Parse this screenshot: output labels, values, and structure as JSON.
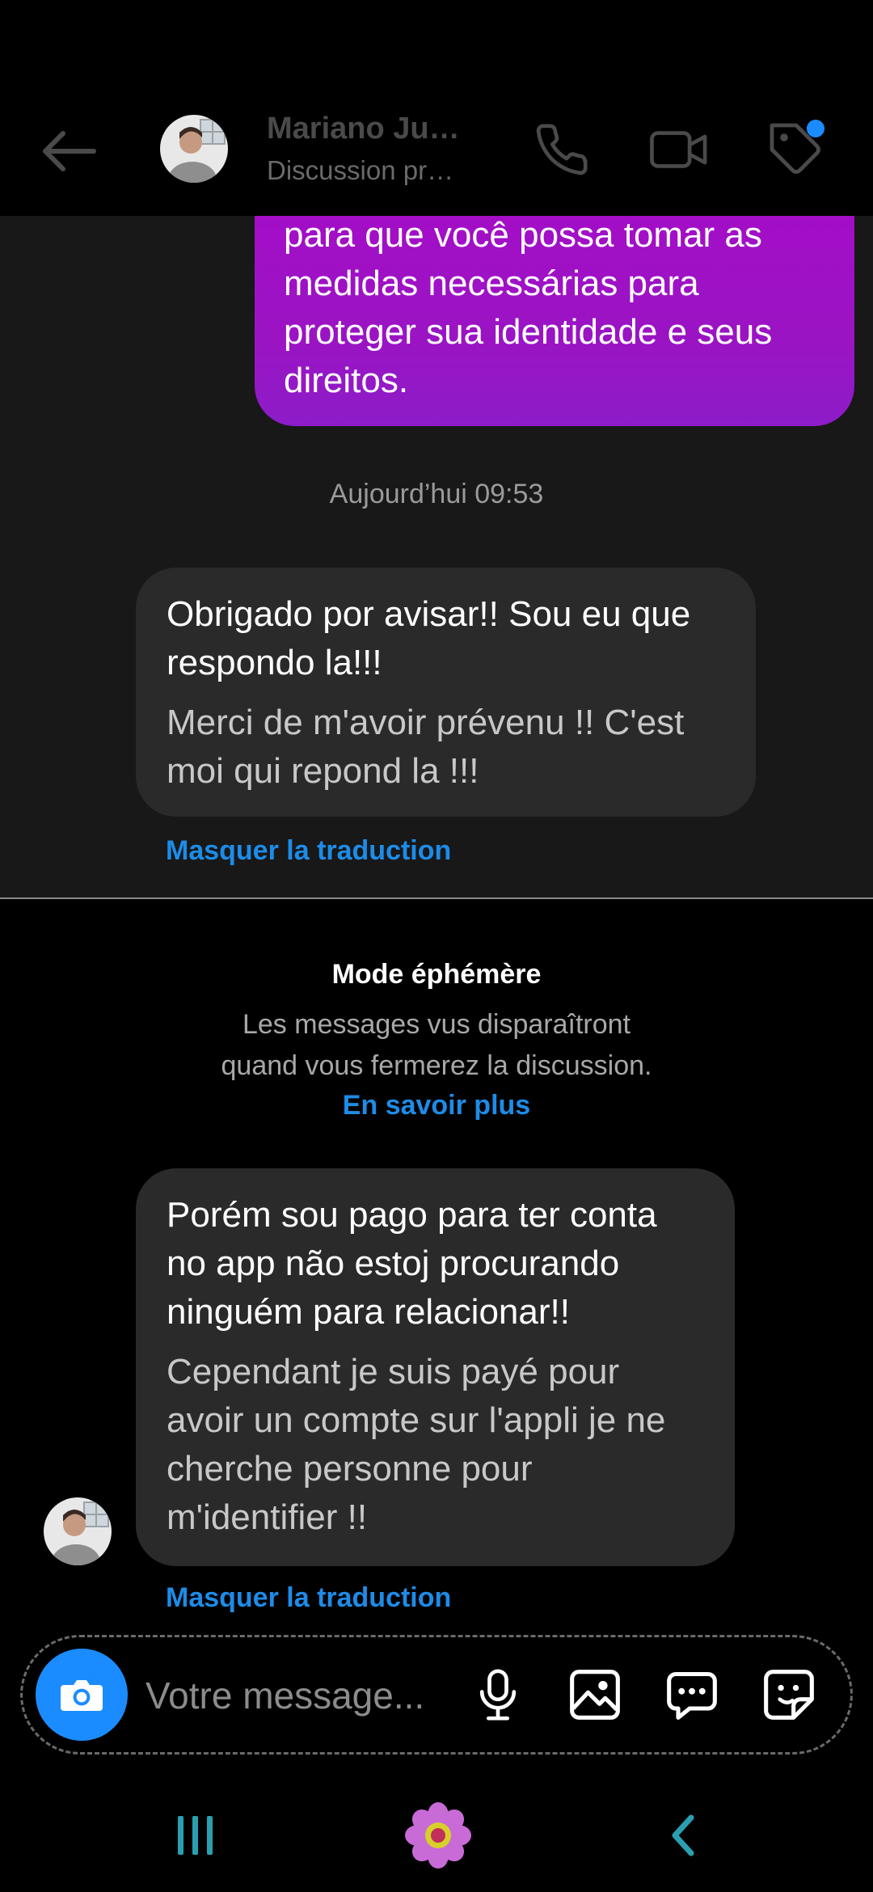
{
  "header": {
    "contact_name": "Mariano Ju…",
    "subtitle": "Discussion pr…",
    "icons": [
      "back-arrow-icon",
      "phone-icon",
      "video-camera-icon",
      "tag-icon"
    ],
    "notification_color": "#1a8cff"
  },
  "messages": {
    "sent_partial": "para que você possa tomar as medidas necessárias para proteger sua identidade e seus direitos.",
    "timestamp": "Aujourd’hui 09:53",
    "received_1": {
      "original": "Obrigado por avisar!! Sou eu que respondo la!!!",
      "translation": "Merci de m'avoir prévenu !! C'est moi qui repond la !!!",
      "hide_translation": "Masquer la traduction"
    },
    "received_2": {
      "original": "Porém sou pago para ter conta no app não estoj procurando ninguém para relacionar!!",
      "translation": "Cependant je suis payé pour avoir un compte sur l'appli je ne cherche personne pour m'identifier !!",
      "hide_translation": "Masquer la traduction"
    }
  },
  "ephemeral": {
    "title": "Mode éphémère",
    "description_line1": "Les messages vus disparaîtront",
    "description_line2": "quand vous fermerez la discussion.",
    "link": "En savoir plus"
  },
  "composer": {
    "placeholder": "Votre message...",
    "icons": [
      "camera-icon",
      "microphone-icon",
      "image-icon",
      "chat-bubble-icon",
      "sticker-icon"
    ],
    "accent": "#1a8cff"
  },
  "navbar": {
    "icons": [
      "recent-apps-icon",
      "home-flower-icon",
      "back-chevron-icon"
    ]
  },
  "colors": {
    "sent_bubble": "#9a14c4",
    "received_bubble": "#2a2a2a",
    "link": "#1d8ce8"
  }
}
